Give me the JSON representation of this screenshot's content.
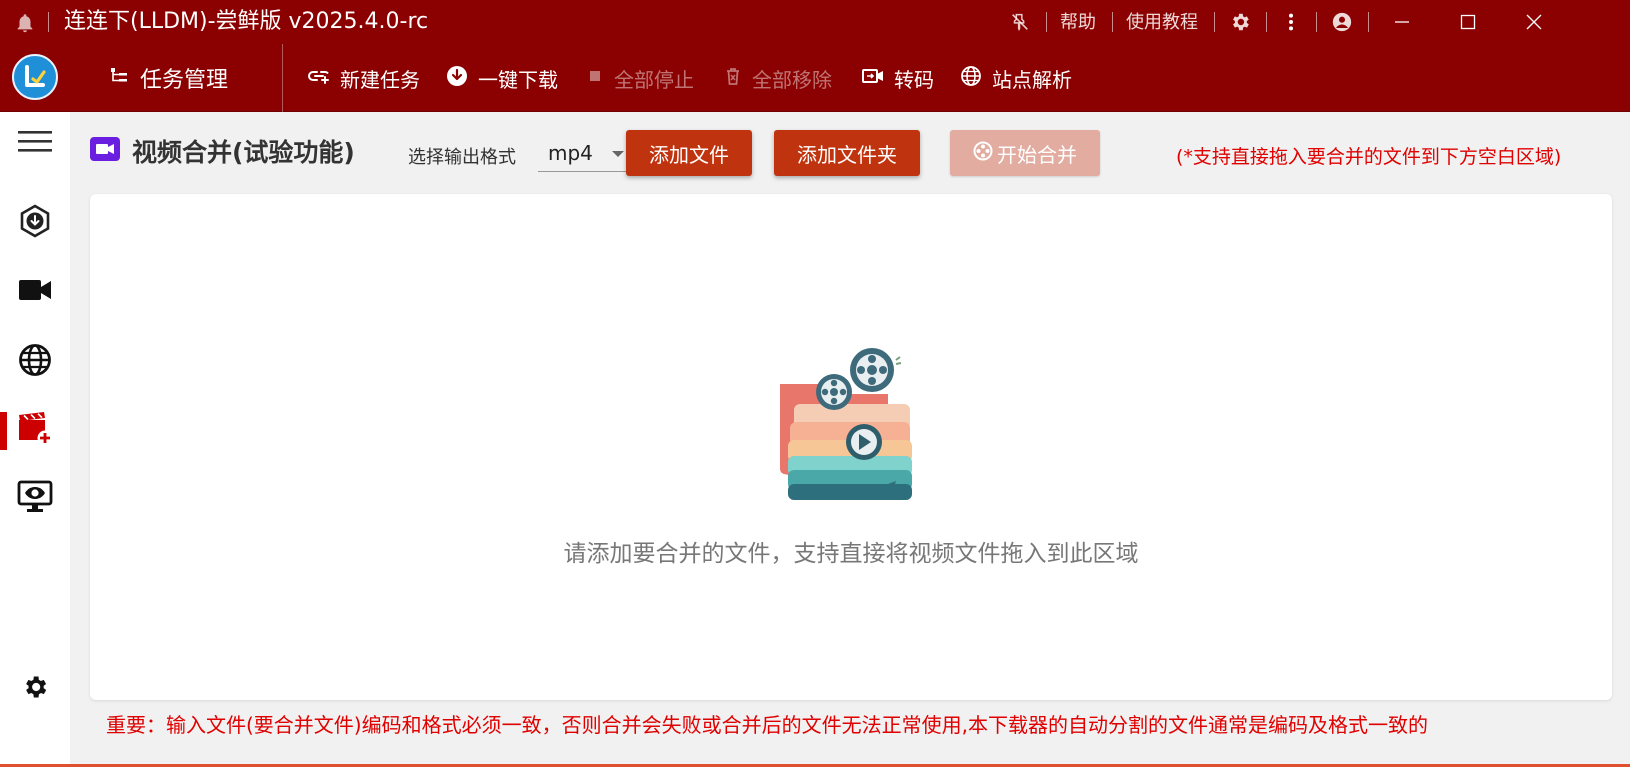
{
  "window": {
    "title": "连连下(LLDM)-尝鲜版 v2025.4.0-rc",
    "help_label": "帮助",
    "tutorial_label": "使用教程",
    "icons": [
      "bell-icon",
      "unpin-icon",
      "gear-icon",
      "more-vert-icon",
      "account-icon",
      "minimize-icon",
      "maximize-icon",
      "close-icon"
    ]
  },
  "toolbar": {
    "task_manager_label": "任务管理",
    "new_task_label": "新建任务",
    "download_all_label": "一键下载",
    "stop_all_label": "全部停止",
    "remove_all_label": "全部移除",
    "transcode_label": "转码",
    "site_parse_label": "站点解析"
  },
  "sidebar": {
    "items": [
      {
        "name": "menu",
        "icon": "hamburger-icon"
      },
      {
        "name": "download",
        "icon": "download-icon"
      },
      {
        "name": "video",
        "icon": "video-camera-icon"
      },
      {
        "name": "web",
        "icon": "globe-icon"
      },
      {
        "name": "video-merge",
        "icon": "video-add-icon",
        "active": true
      },
      {
        "name": "monitor",
        "icon": "monitor-eye-icon"
      },
      {
        "name": "settings",
        "icon": "gear-icon"
      }
    ]
  },
  "main": {
    "page_title": "视频合并(试验功能)",
    "format_label": "选择输出格式",
    "format_value": "mp4",
    "add_file_label": "添加文件",
    "add_folder_label": "添加文件夹",
    "start_merge_label": "开始合并",
    "drag_hint": "(*支持直接拖入要合并的文件到下方空白区域)",
    "drop_zone_text": "请添加要合并的文件，支持直接将视频文件拖入到此区域",
    "important_note": "重要：输入文件(要合并文件)编码和格式必须一致，否则合并会失败或合并后的文件无法正常使用,本下载器的自动分割的文件通常是编码及格式一致的"
  },
  "colors": {
    "titlebar": "#8b0000",
    "primary_button": "#c0330f",
    "disabled_button": "#e2aca0",
    "warning_text": "#e00000",
    "active_marker": "#cc0000"
  }
}
